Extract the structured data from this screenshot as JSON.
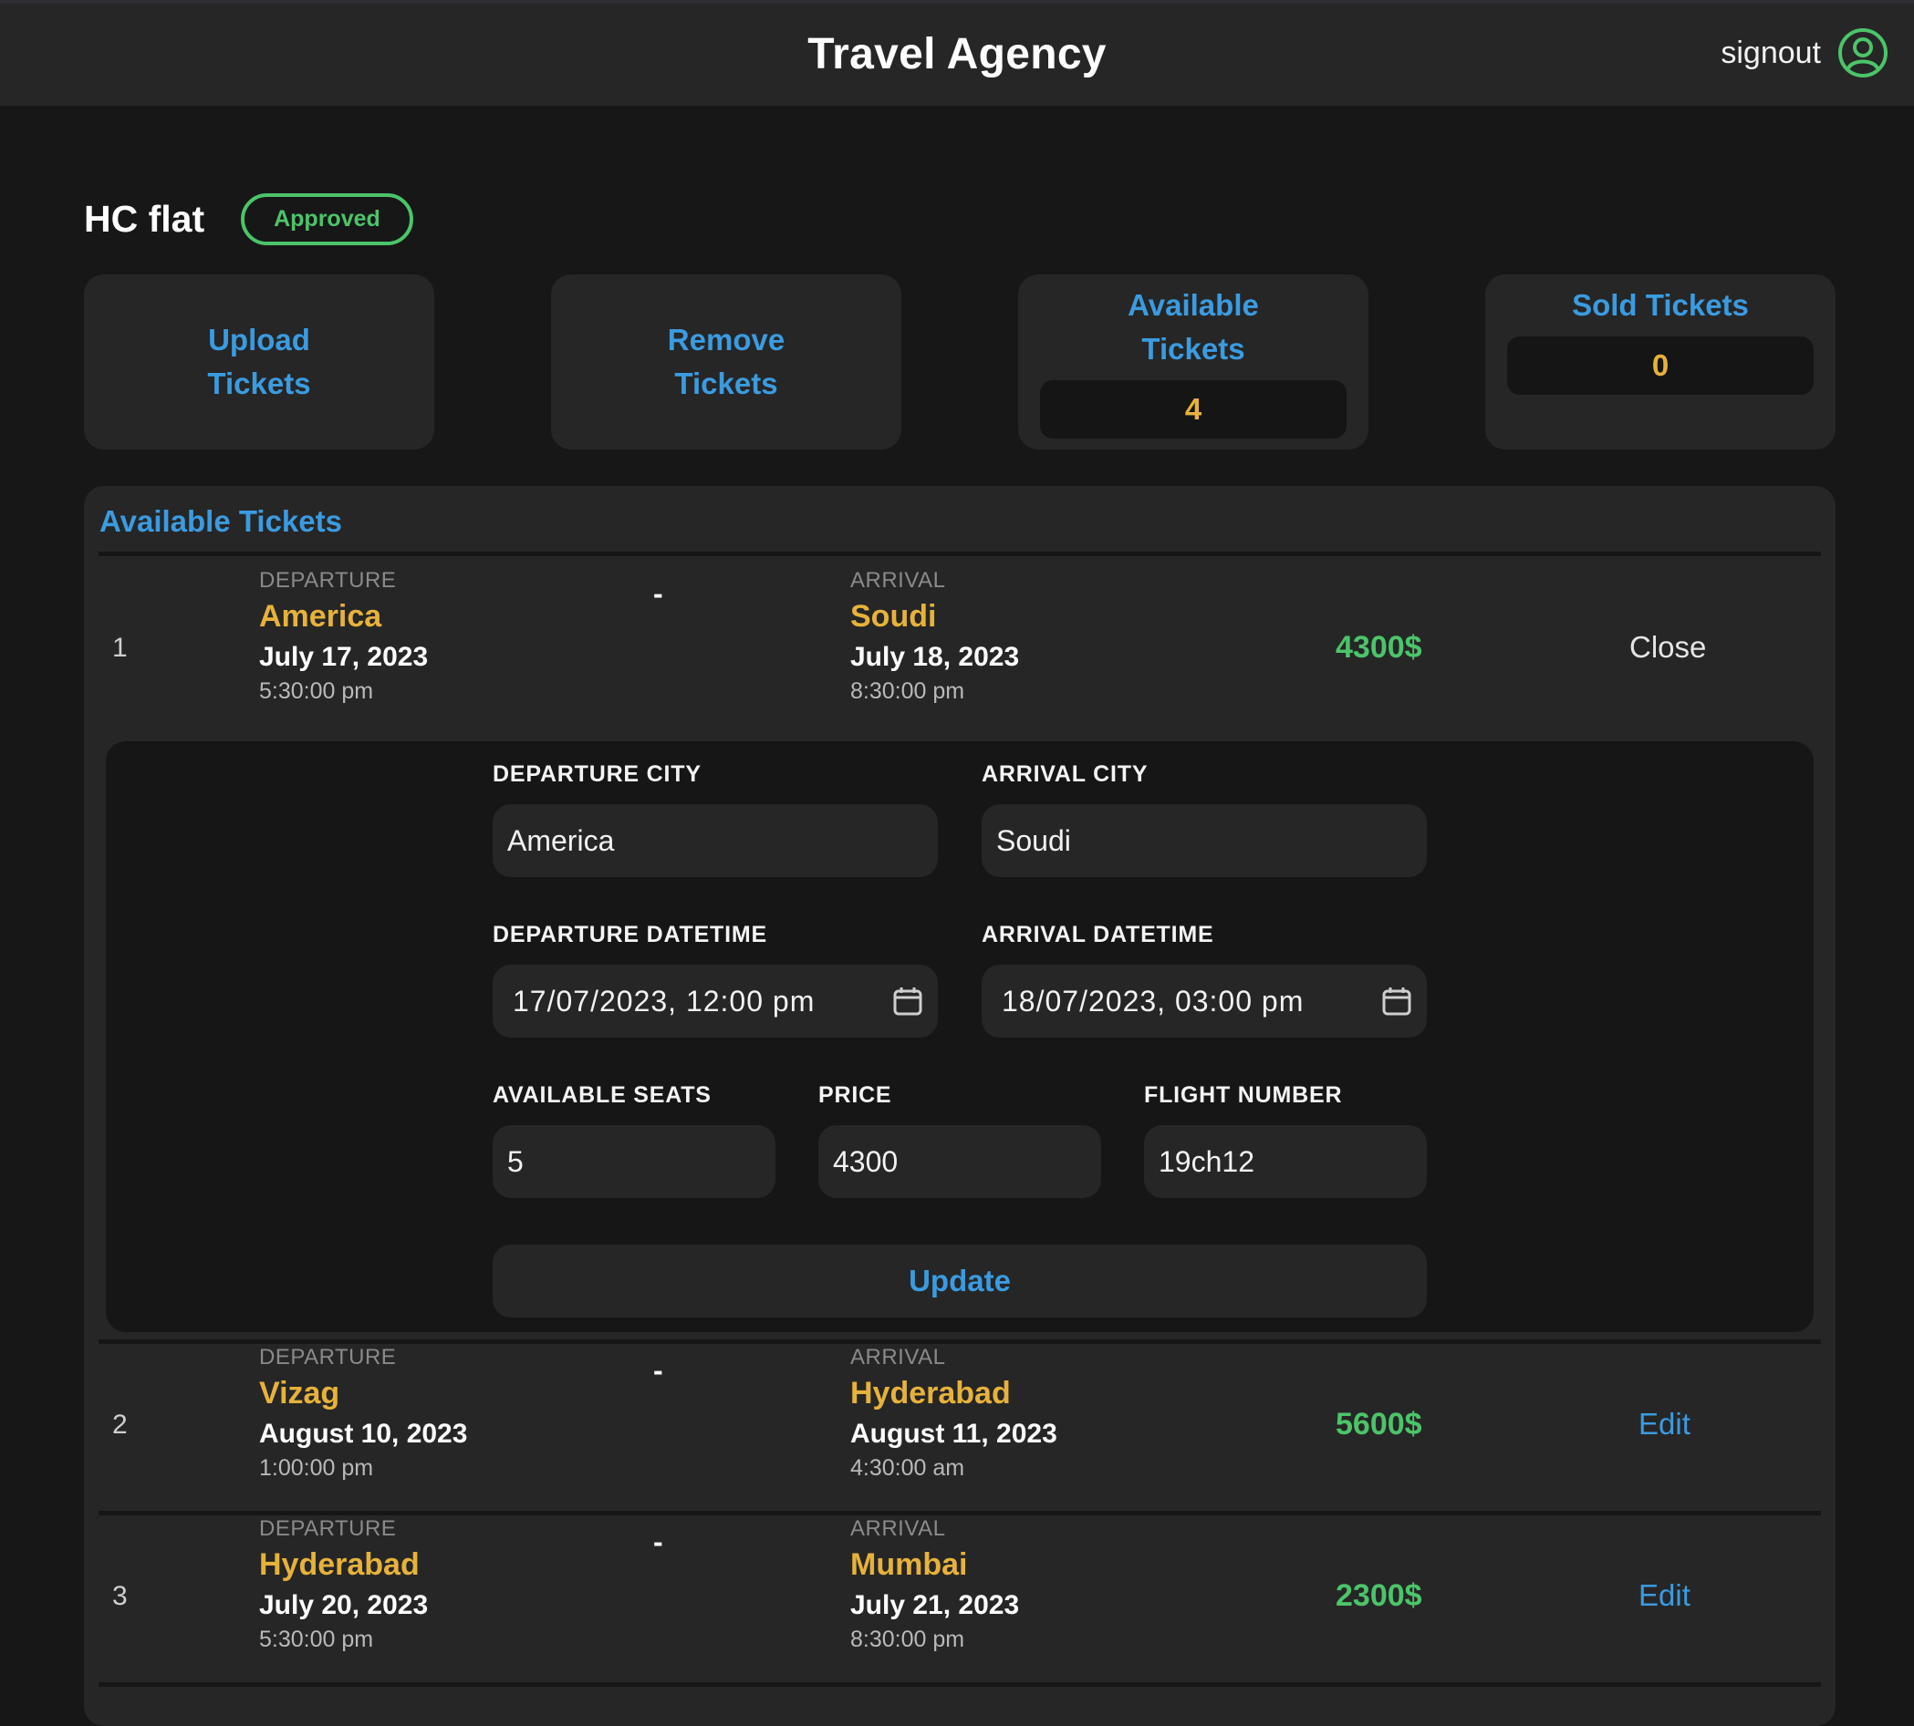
{
  "header": {
    "title": "Travel Agency",
    "signout_label": "signout",
    "avatar_icon": "user-circle-icon",
    "accent_color": "#4cc46a"
  },
  "page": {
    "title": "HC flat",
    "status": "Approved"
  },
  "cards": {
    "upload": "Upload Tickets",
    "remove": "Remove Tickets",
    "available_label": "Available Tickets",
    "available_count": "4",
    "sold_label": "Sold Tickets",
    "sold_count": "0"
  },
  "tickets_panel": {
    "title": "Available Tickets",
    "departure_label": "DEPARTURE",
    "arrival_label": "ARRIVAL",
    "separator": "-",
    "rows": [
      {
        "index": "1",
        "departure_city": "America",
        "departure_date": "July 17, 2023",
        "departure_time": "5:30:00 pm",
        "arrival_city": "Soudi",
        "arrival_date": "July 18, 2023",
        "arrival_time": "8:30:00 pm",
        "price": "4300$",
        "action": "Close"
      },
      {
        "index": "2",
        "departure_city": "Vizag",
        "departure_date": "August 10, 2023",
        "departure_time": "1:00:00 pm",
        "arrival_city": "Hyderabad",
        "arrival_date": "August 11, 2023",
        "arrival_time": "4:30:00 am",
        "price": "5600$",
        "action": "Edit"
      },
      {
        "index": "3",
        "departure_city": "Hyderabad",
        "departure_date": "July 20, 2023",
        "departure_time": "5:30:00 pm",
        "arrival_city": "Mumbai",
        "arrival_date": "July 21, 2023",
        "arrival_time": "8:30:00 pm",
        "price": "2300$",
        "action": "Edit"
      }
    ]
  },
  "editor": {
    "departure_city_label": "DEPARTURE CITY",
    "departure_city_value": "America",
    "arrival_city_label": "ARRIVAL CITY",
    "arrival_city_value": "Soudi",
    "departure_datetime_label": "DEPARTURE DATETIME",
    "departure_datetime_value": "17/07/2023, 12:00 pm",
    "arrival_datetime_label": "ARRIVAL DATETIME",
    "arrival_datetime_value": "18/07/2023, 03:00 pm",
    "seats_label": "AVAILABLE SEATS",
    "seats_value": "5",
    "price_label": "PRICE",
    "price_value": "4300",
    "flight_label": "FLIGHT NUMBER",
    "flight_value": "19ch12",
    "update_label": "Update",
    "calendar_icon": "calendar-icon"
  },
  "colors": {
    "link_blue": "#3b9be0",
    "city_yellow": "#e7b23b",
    "price_green": "#4cc46a"
  }
}
